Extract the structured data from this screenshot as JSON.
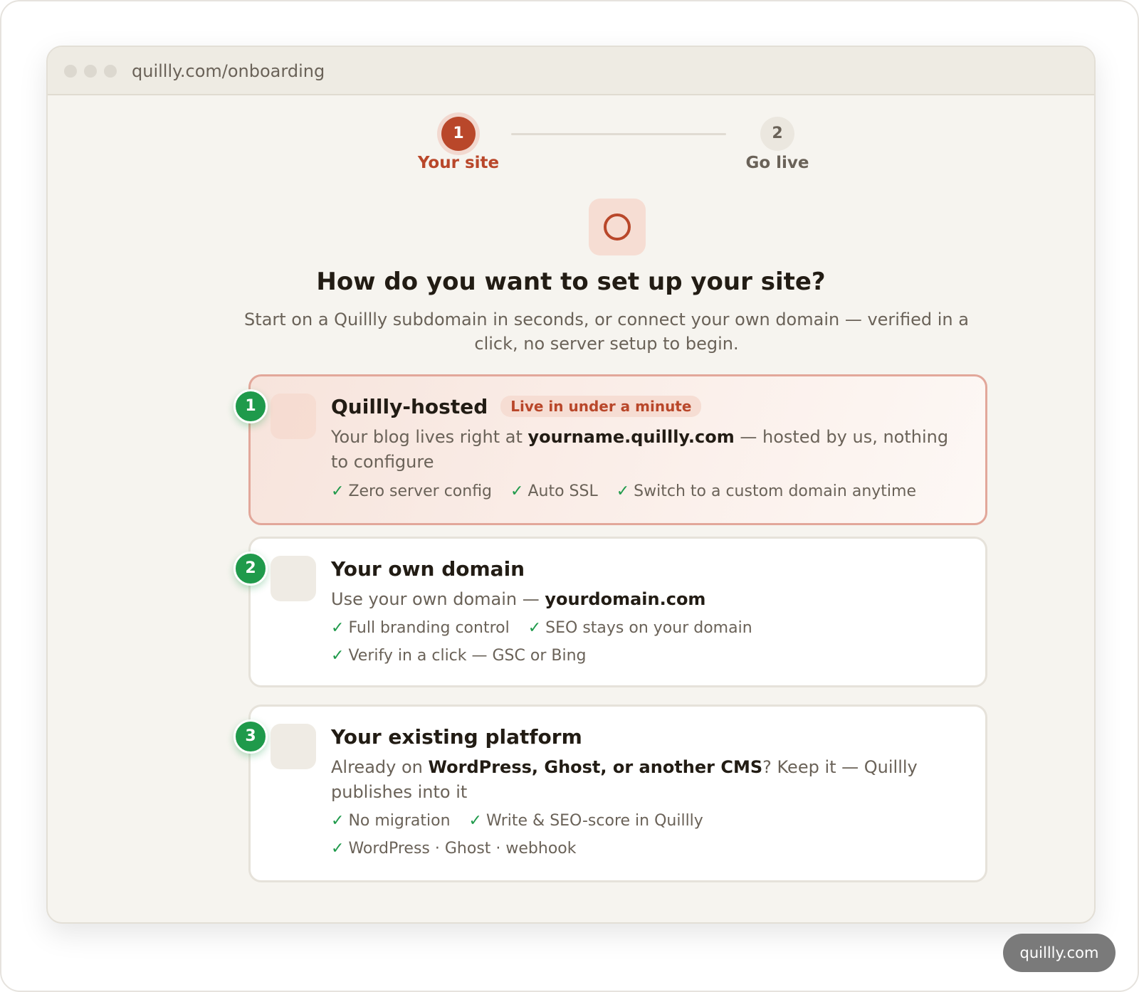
{
  "browser": {
    "url": "quillly.com/onboarding"
  },
  "stepper": {
    "steps": [
      {
        "number": "1",
        "label": "Your site"
      },
      {
        "number": "2",
        "label": "Go live"
      }
    ],
    "active_step": 1
  },
  "header": {
    "title": "How do you want to set up your site?",
    "subtitle": "Start on a Quillly subdomain in seconds, or connect your own domain — verified in a click, no server setup to begin."
  },
  "options": [
    {
      "number": "1",
      "title": "Quillly-hosted",
      "badge": "Live in under a minute",
      "desc_pre": "Your blog lives right at ",
      "desc_bold": "yourname.quillly.com",
      "desc_post": " — hosted by us, nothing to configure",
      "features": [
        "Zero server config",
        "Auto SSL",
        "Switch to a custom domain anytime"
      ],
      "selected": true
    },
    {
      "number": "2",
      "title": "Your own domain",
      "desc_pre": "Use your own domain — ",
      "desc_bold": "yourdomain.com",
      "desc_post": "",
      "features": [
        "Full branding control",
        "SEO stays on your domain",
        "Verify in a click — GSC or Bing"
      ],
      "selected": false
    },
    {
      "number": "3",
      "title": "Your existing platform",
      "desc_pre": "Already on ",
      "desc_bold": "WordPress, Ghost, or another CMS",
      "desc_post": "? Keep it — Quillly publishes into it",
      "features": [
        "No migration",
        "Write & SEO-score in Quillly",
        "WordPress · Ghost · webhook"
      ],
      "selected": false
    }
  ],
  "check_glyph": "✓",
  "footer": {
    "watermark": "quillly.com"
  },
  "colors": {
    "accent": "#b9472a",
    "success": "#1f9a4b",
    "background": "#f6f4ef"
  }
}
